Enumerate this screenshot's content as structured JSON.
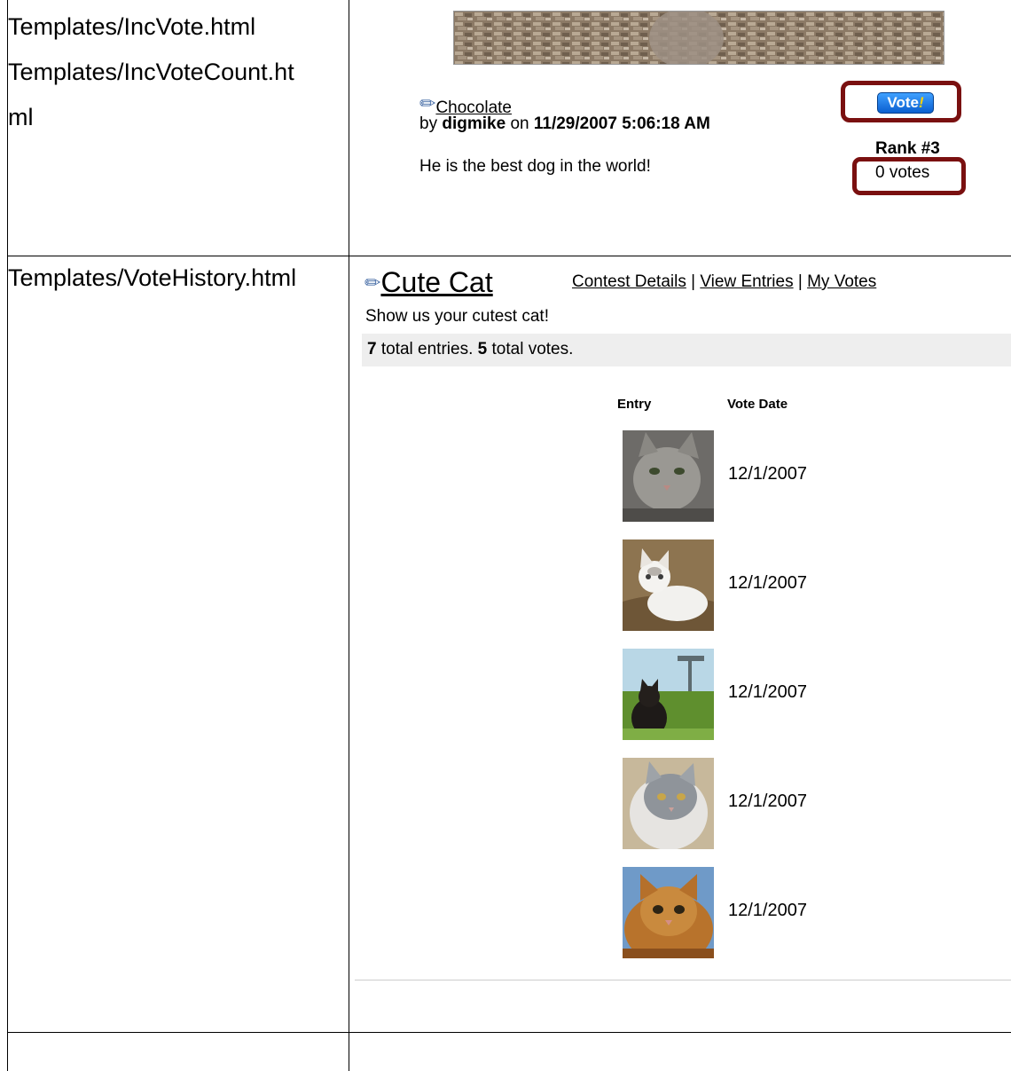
{
  "left_column": {
    "row1_paths": [
      "Templates/IncVote.html",
      "Templates/IncVoteCount.ht",
      "ml"
    ],
    "row2_path": "Templates/VoteHistory.html"
  },
  "inc_vote": {
    "entry_title": "Chocolate",
    "by_label": "by",
    "author": "digmike",
    "on_label": "on",
    "date": "11/29/2007 5:06:18 AM",
    "description": "He is the best dog in the world!",
    "vote_button_label": "Vote",
    "vote_button_suffix": "!",
    "rank": "Rank #3",
    "vote_count": "0 votes",
    "highlight_color": "#7a1010",
    "button_color": "#0a5fd0"
  },
  "vote_history": {
    "contest_title": "Cute Cat",
    "links": [
      "Contest Details",
      "View Entries",
      "My Votes"
    ],
    "link_separator": "|",
    "description": "Show us your cutest cat!",
    "total_entries": "7",
    "entries_label": "total entries.",
    "total_votes": "5",
    "votes_label": "total votes.",
    "columns": [
      "Entry",
      "Vote Date"
    ],
    "rows": [
      {
        "image": "gray-tabby-cat-photo",
        "date": "12/1/2007"
      },
      {
        "image": "white-kitten-in-basket-photo",
        "date": "12/1/2007"
      },
      {
        "image": "black-cat-in-grass-photo",
        "date": "12/1/2007"
      },
      {
        "image": "long-haired-gray-cat-photo",
        "date": "12/1/2007"
      },
      {
        "image": "orange-tabby-cat-photo",
        "date": "12/1/2007"
      }
    ]
  }
}
